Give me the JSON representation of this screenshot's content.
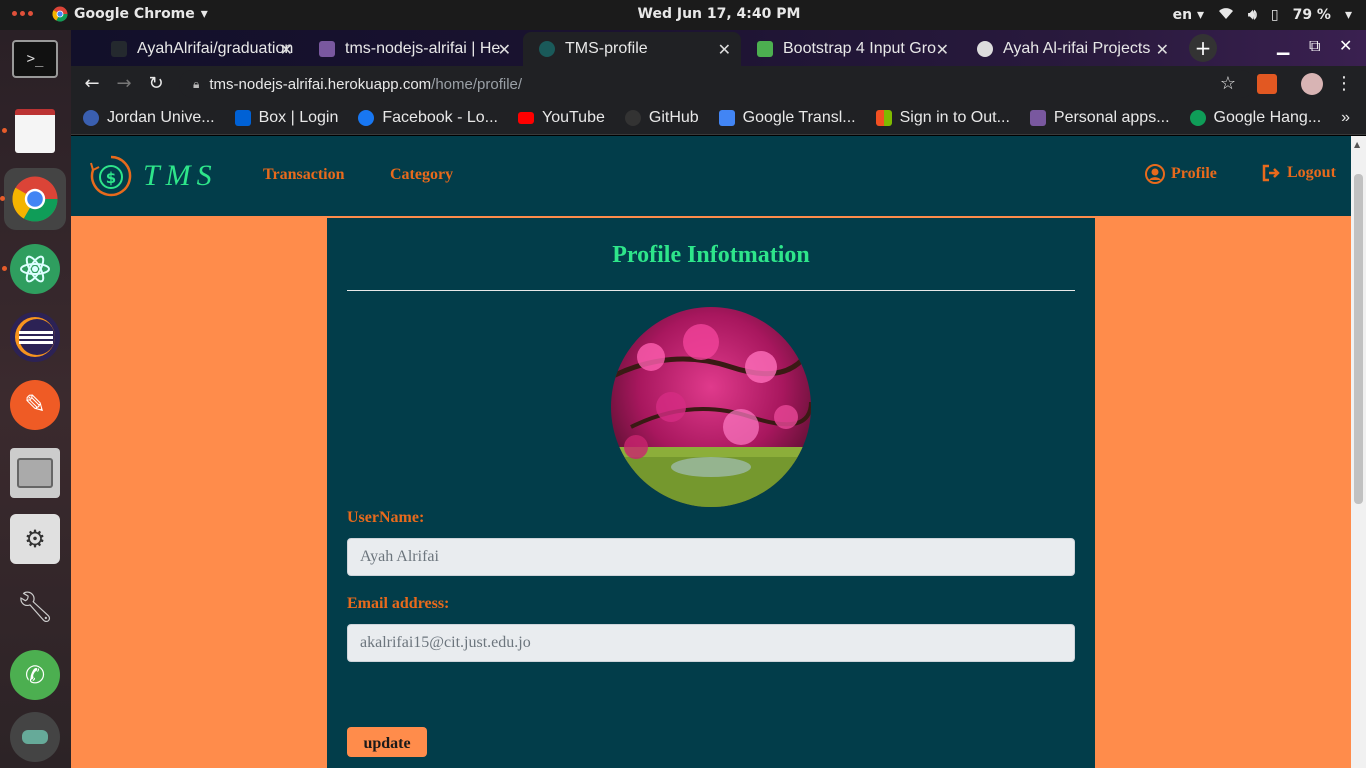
{
  "os": {
    "app_name": "Google Chrome",
    "clock": "Wed Jun 17,  4:40 PM",
    "lang": "en",
    "battery": "79 %"
  },
  "tabs": [
    {
      "title": "AyahAlrifai/graduation",
      "color": "#24292e"
    },
    {
      "title": "tms-nodejs-alrifai | He",
      "color": "#79589f"
    },
    {
      "title": "TMS-profile",
      "color": "#1a5a5a"
    },
    {
      "title": "Bootstrap 4 Input Gro",
      "color": "#4caf50"
    },
    {
      "title": "Ayah Al-rifai Projects",
      "color": "#dddddd"
    }
  ],
  "address": {
    "host": "tms-nodejs-alrifai.herokuapp.com",
    "path": "/home/profile/"
  },
  "bookmarks": [
    {
      "label": "Jordan Unive...",
      "color": "#3a5fb0"
    },
    {
      "label": "Box | Login",
      "color": "#0061d5"
    },
    {
      "label": "Facebook - Lo...",
      "color": "#1877f2"
    },
    {
      "label": "YouTube",
      "color": "#ff0000"
    },
    {
      "label": "GitHub",
      "color": "#333333"
    },
    {
      "label": "Google Transl...",
      "color": "#4285f4"
    },
    {
      "label": "Sign in to Out...",
      "color": "#f25022"
    },
    {
      "label": "Personal apps...",
      "color": "#79589f"
    },
    {
      "label": "Google Hang...",
      "color": "#0f9d58"
    }
  ],
  "site": {
    "brand": "TMS",
    "nav": {
      "transaction": "Transaction",
      "category": "Category",
      "profile": "Profile",
      "logout": "Logout"
    }
  },
  "profile": {
    "title": "Profile Infotmation",
    "username_label": "UserName:",
    "username_value": "Ayah Alrifai",
    "email_label": "Email address:",
    "email_value": "akalrifai15@cit.just.edu.jo",
    "update_label": "update"
  },
  "colors": {
    "page_bg": "#ff8c4b",
    "panel_bg": "#023d4a",
    "accent_green": "#2ee58a",
    "accent_orange": "#e86a1c"
  }
}
